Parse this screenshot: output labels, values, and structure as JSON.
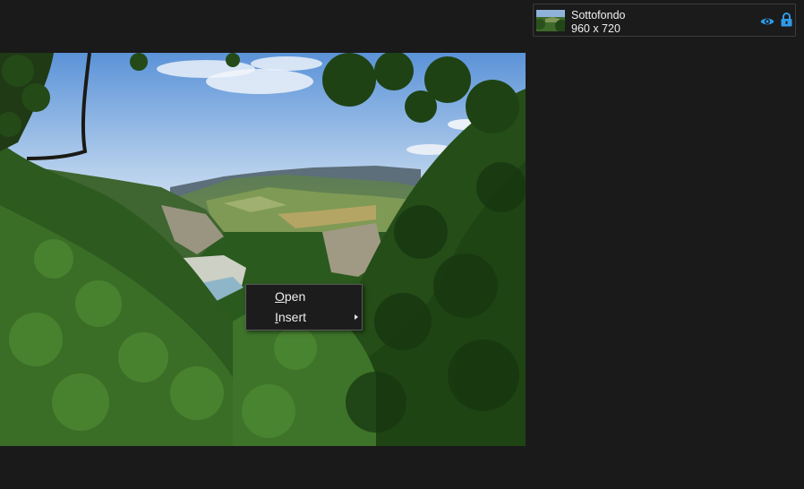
{
  "canvas": {
    "image_description_icon": "landscape-photo"
  },
  "layers": {
    "items": [
      {
        "name": "Sottofondo",
        "size": "960 x 720",
        "visible_icon": "eye-icon",
        "lock_icon": "lock-icon"
      }
    ]
  },
  "context_menu": {
    "items": [
      {
        "label_mnemonic": "O",
        "label_rest": "pen",
        "has_submenu": false
      },
      {
        "label_mnemonic": "I",
        "label_rest": "nsert",
        "has_submenu": true
      }
    ]
  },
  "colors": {
    "background": "#1a1a1a",
    "accent_icon": "#2f9be8",
    "menu_border": "#5a5a5a"
  }
}
